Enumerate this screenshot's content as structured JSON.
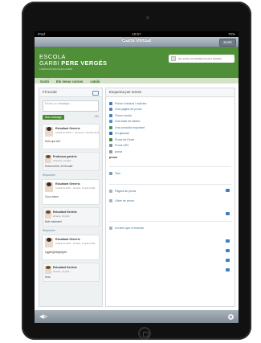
{
  "status": {
    "carrier": "iPad",
    "time": "10:57",
    "battery": "70%"
  },
  "nav": {
    "title": "Garbi Virtual",
    "exit_label": "Sortir"
  },
  "header": {
    "logo_line1": "ESCOLA",
    "logo_garbi": "GARBI",
    "logo_pere": "PERE VERGÉS",
    "logo_sub": "FUNDACIÓ ESCOLES GARBI"
  },
  "user": {
    "text": "Heu entrat com Estudiant Genèric (Sortida)"
  },
  "menu": {
    "items": [
      "Garbi",
      "Els meus cursos",
      "català"
    ]
  },
  "left": {
    "title": "Fil social",
    "placeholder": "Escriu un missatge...",
    "send_label": "Nou missatge",
    "counter": "140",
    "posts": [
      {
        "name": "Estudiant Genèric",
        "sub": "Cadell de ESO 2 · dimecres, 13 juliol 2011",
        "msg": "Hola que tal?"
      },
      {
        "name": "Estudiant Genèric",
        "sub": "Cadell de ESO · dimarts, 12 juliol 2011",
        "msg": "Coco-mmm"
      },
      {
        "name": "Estudiant Genèric",
        "sub": "Cadell de ESO · dimarts, 12 juliol 2011",
        "msg": "eggthfgtbfdgfdgfbv"
      }
    ],
    "replies": [
      {
        "name": "Professor genèric",
        "sub": "dimecres, 13 juliol",
        "msg": "Hola molt bé, et'l trucaré"
      },
      {
        "name": "Estudiant Genèric",
        "sub": "dimarts, 12 juliol",
        "msg": "Molt malament"
      },
      {
        "name": "Estudiant Genèric",
        "sub": "dimarts, 12 juliol",
        "msg": "Hola"
      }
    ],
    "reply_label": "Respondre"
  },
  "right": {
    "title": "Esquema per temes",
    "items": [
      {
        "label": "Fòrum d'avisos i notícies",
        "icon": "forum-icon",
        "color": "#3f7fc1"
      },
      {
        "label": "Una pàgina de prova",
        "icon": "page-icon",
        "color": "#6a7fa0"
      },
      {
        "label": "Fòrum social",
        "icon": "forum-icon",
        "color": "#3f7fc1"
      },
      {
        "label": "Una base de dades",
        "icon": "database-icon",
        "color": "#5b8fc5"
      },
      {
        "label": "Una consulta important",
        "icon": "poll-icon",
        "color": "#3f9a52"
      },
      {
        "label": "Un glossari",
        "icon": "glossary-icon",
        "color": "#2f6ea8"
      },
      {
        "label": "Prova de Excel",
        "icon": "excel-icon",
        "color": "#3a8a3a"
      },
      {
        "label": "Prova URL",
        "icon": "link-icon",
        "color": "#7a8ea2"
      },
      {
        "label": "prova",
        "icon": "file-icon",
        "color": "#8f9aa5"
      }
    ],
    "extra_text": "prova",
    "section1": {
      "label": "Test"
    },
    "section2": [
      {
        "label": "Pàgina de prova"
      },
      {
        "label": "Llibre de prova"
      }
    ],
    "section3": {
      "label": "Un item que m'inventa"
    }
  }
}
